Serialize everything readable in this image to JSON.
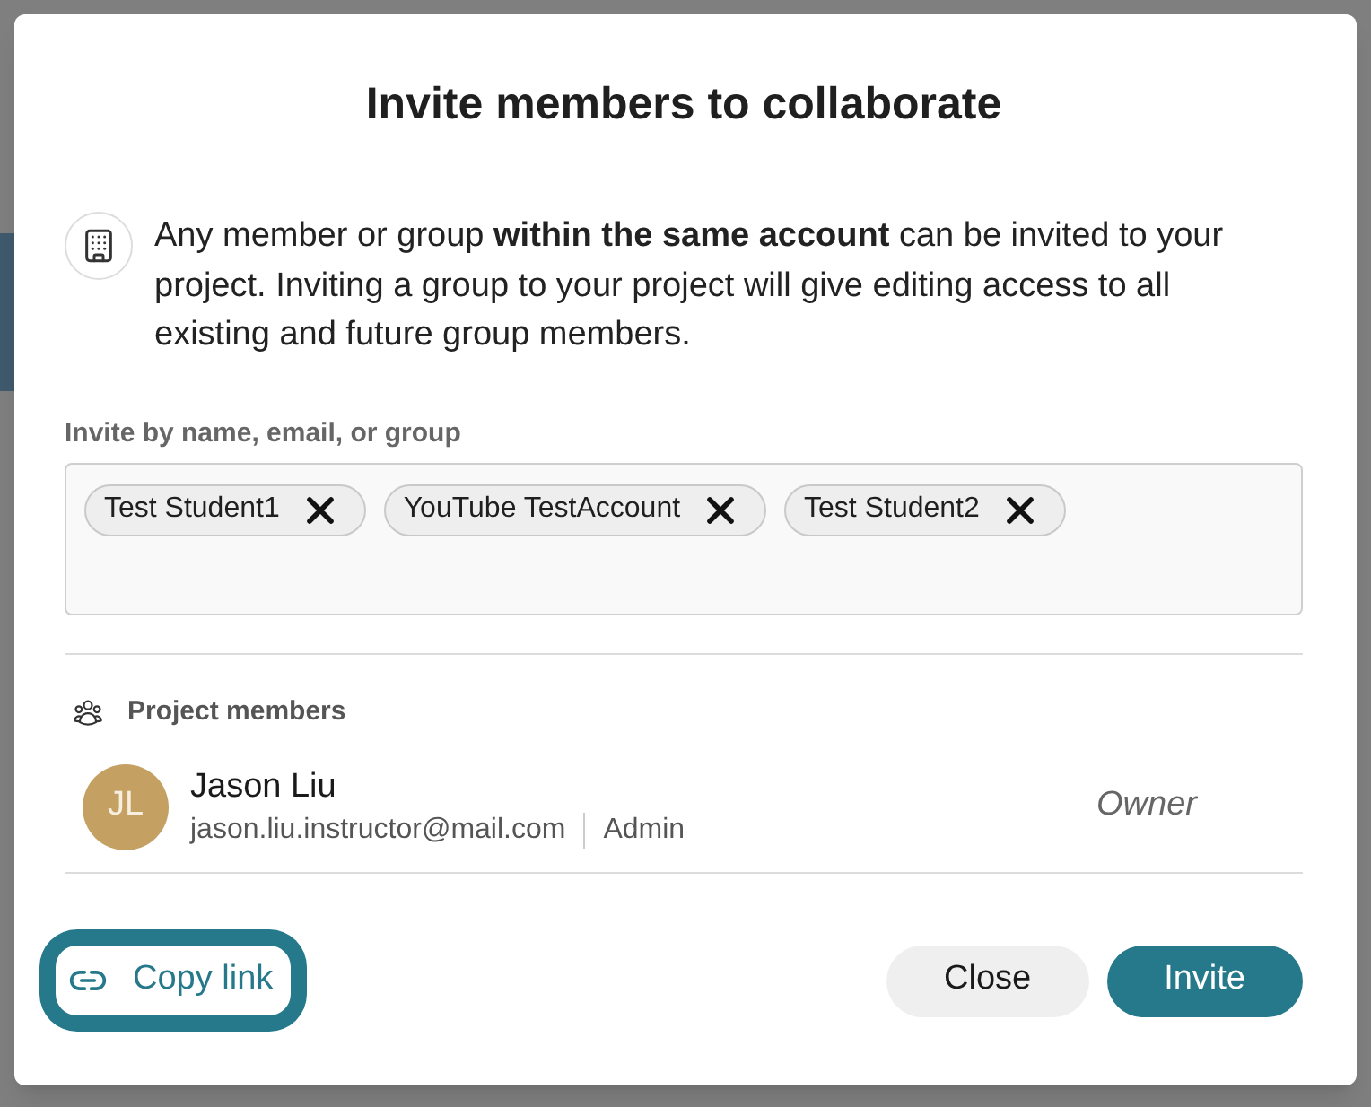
{
  "dialog": {
    "title": "Invite members to collaborate",
    "notice": {
      "text": "Any member or group **within the same account** can be invited to your project. Inviting a group to your project will give editing access to all existing and future group members."
    },
    "invite_field": {
      "label": "Invite by name, email, or group",
      "chips": [
        {
          "label": "Test Student1"
        },
        {
          "label": "YouTube TestAccount"
        },
        {
          "label": "Test Student2"
        }
      ]
    },
    "members_section": {
      "heading": "Project members",
      "members": [
        {
          "initials": "JL",
          "name": "Jason Liu",
          "email": "jason.liu.instructor@mail.com",
          "account_role": "Admin",
          "project_role": "Owner",
          "color": "#c4a163"
        }
      ]
    },
    "footer": {
      "copy_link": {
        "label": "Copy link",
        "focused": true
      },
      "buttons": [
        {
          "label": "Close",
          "kind": "secondary"
        },
        {
          "label": "Invite",
          "kind": "primary"
        }
      ]
    }
  }
}
